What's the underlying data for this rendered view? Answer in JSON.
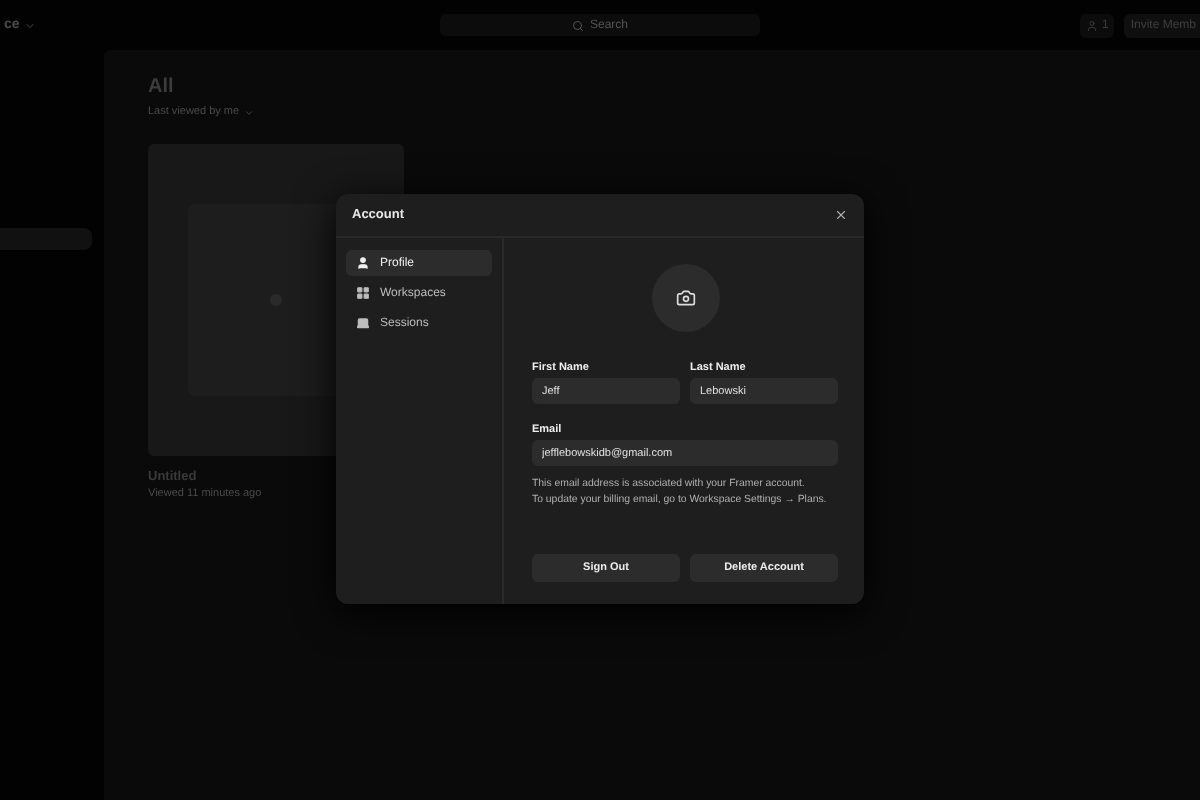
{
  "top_bar": {
    "workspace": "ce",
    "search": {
      "placeholder": "Search"
    },
    "members_count": "1",
    "invite_button": "Invite Memb"
  },
  "sidebar": {
    "items": [
      {
        "selected": true
      }
    ]
  },
  "main": {
    "title": "All",
    "sort": "Last viewed by me",
    "projects": [
      {
        "name": "Untitled",
        "meta": "Viewed 11 minutes ago",
        "kind": "picture"
      }
    ]
  },
  "dialog": {
    "title": "Account",
    "nav": [
      {
        "label": "Profile",
        "kind": "person",
        "selected": true
      },
      {
        "label": "Workspaces",
        "kind": "grid",
        "selected": false
      },
      {
        "label": "Sessions",
        "kind": "laptop",
        "selected": false
      }
    ],
    "first_name": {
      "label": "First Name",
      "value": "Jeff"
    },
    "last_name": {
      "label": "Last Name",
      "value": "Lebowski"
    },
    "email": {
      "label": "Email",
      "value": "jefflebowskidb@gmail.com"
    },
    "help": [
      "This email address is associated with your Framer account.",
      "To update your billing email, go to Workspace Settings → Plans."
    ],
    "buttons": [
      "Sign Out",
      "Delete Account"
    ]
  }
}
